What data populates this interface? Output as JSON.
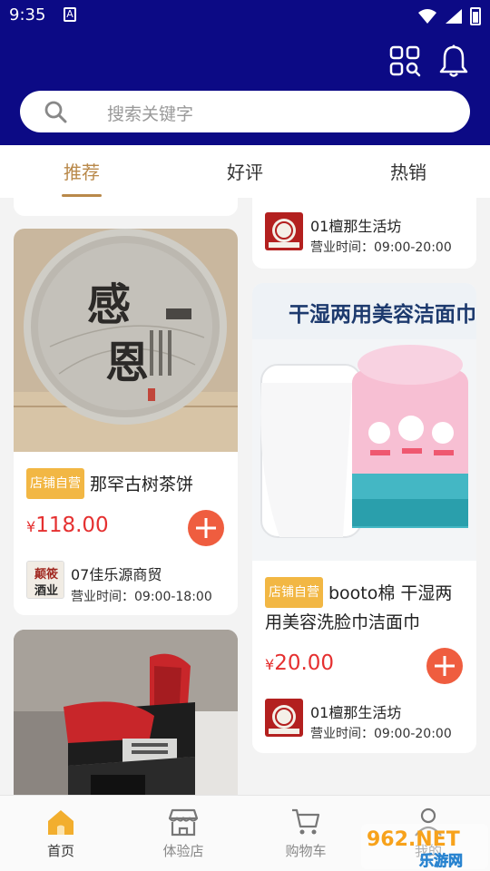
{
  "status_bar": {
    "time": "9:35",
    "extra_glyph": "A"
  },
  "header": {
    "icons": [
      "scan-grid-icon",
      "bell-icon"
    ]
  },
  "search": {
    "placeholder": "搜索关键字"
  },
  "tabs": [
    {
      "label": "推荐",
      "active": true
    },
    {
      "label": "好评",
      "active": false
    },
    {
      "label": "热销",
      "active": false
    }
  ],
  "feed": {
    "top_right_partial": {
      "shop_name": "01檀那生活坊",
      "hours": "营业时间：09:00-20:00"
    },
    "left_card_1": {
      "image_text": [
        "感",
        "恩"
      ],
      "badge": "店铺自营",
      "title": "那罕古树茶饼",
      "currency": "¥",
      "price": "118.00",
      "shop_name": "07佳乐源商贸",
      "shop_logo_text": [
        "颠筱",
        "酒业"
      ],
      "hours": "营业时间：09:00-18:00"
    },
    "right_card_2": {
      "image_headline": "干湿两用美容洁面巾",
      "badge": "店铺自营",
      "title": "booto棉 干湿两用美容洗脸巾洁面巾",
      "currency": "¥",
      "price": "20.00",
      "shop_name": "01檀那生活坊",
      "hours": "营业时间：09:00-20:00"
    }
  },
  "bottom_nav": [
    {
      "label": "首页",
      "icon": "home-icon",
      "active": true
    },
    {
      "label": "体验店",
      "icon": "store-icon",
      "active": false
    },
    {
      "label": "购物车",
      "icon": "cart-icon",
      "active": false
    },
    {
      "label": "我的",
      "icon": "user-icon",
      "active": false
    }
  ],
  "watermark": {
    "text": "962.NET",
    "subtext": "乐游网"
  },
  "colors": {
    "header_bg": "#0c0a85",
    "accent_gold": "#b9894a",
    "price_red": "#e53030",
    "badge_yellow": "#f2b744",
    "add_button": "#ef5d3f"
  }
}
